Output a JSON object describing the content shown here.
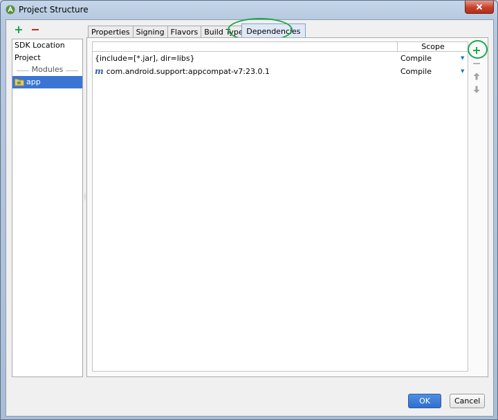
{
  "window": {
    "title": "Project Structure"
  },
  "left_panel": {
    "items": [
      "SDK Location",
      "Project"
    ],
    "modules_header": "Modules",
    "modules": [
      "app"
    ]
  },
  "tabs": [
    {
      "label": "Properties"
    },
    {
      "label": "Signing"
    },
    {
      "label": "Flavors"
    },
    {
      "label": "Build Types"
    },
    {
      "label": "Dependencies",
      "active": true
    }
  ],
  "dependencies": {
    "columns": [
      "",
      "Scope"
    ],
    "rows": [
      {
        "name": "{include=[*.jar], dir=libs}",
        "scope": "Compile",
        "icon": "none"
      },
      {
        "name": "com.android.support:appcompat-v7:23.0.1",
        "scope": "Compile",
        "icon": "maven-icon"
      }
    ]
  },
  "buttons": {
    "ok": "OK",
    "cancel": "Cancel"
  },
  "colors": {
    "accent": "#3a75d4",
    "add_green": "#1aa74a",
    "remove_red": "#cc2222",
    "highlight_circle": "#1aa74a"
  }
}
